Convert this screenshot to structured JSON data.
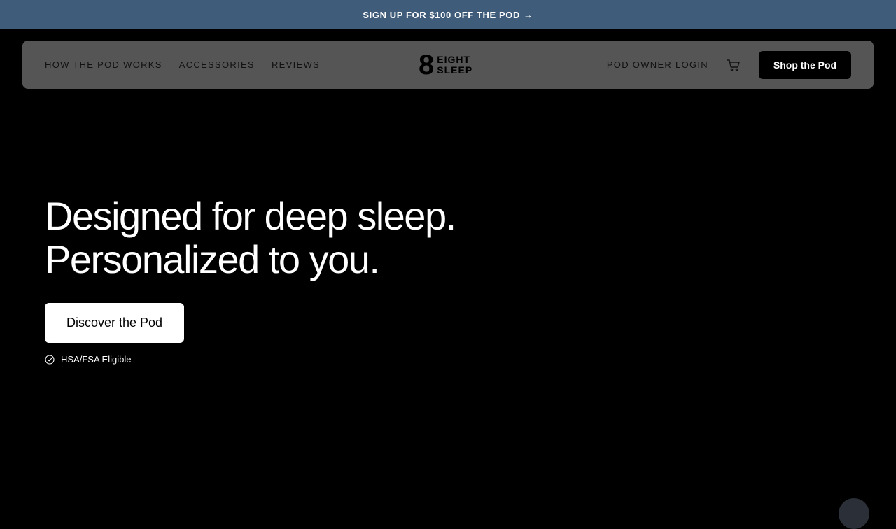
{
  "promo": {
    "text": "SIGN UP FOR $100 OFF THE POD",
    "arrow": "→"
  },
  "nav": {
    "links": [
      "HOW THE POD WORKS",
      "ACCESSORIES",
      "REVIEWS"
    ],
    "login": "POD OWNER LOGIN",
    "shop_button": "Shop the Pod"
  },
  "logo": {
    "mark": "8",
    "line1": "EIGHT",
    "line2": "SLEEP"
  },
  "hero": {
    "title_line1": "Designed for deep sleep.",
    "title_line2": "Personalized to you.",
    "cta": "Discover the Pod",
    "eligible": "HSA/FSA Eligible"
  },
  "icons": {
    "cart": "cart-icon",
    "check": "check-circle-icon",
    "arrow": "arrow-right-icon"
  },
  "colors": {
    "promo_bg": "#3f5c7a",
    "nav_bg": "#555555",
    "page_bg": "#000000",
    "cta_bg": "#ffffff",
    "shop_bg": "#000000"
  }
}
